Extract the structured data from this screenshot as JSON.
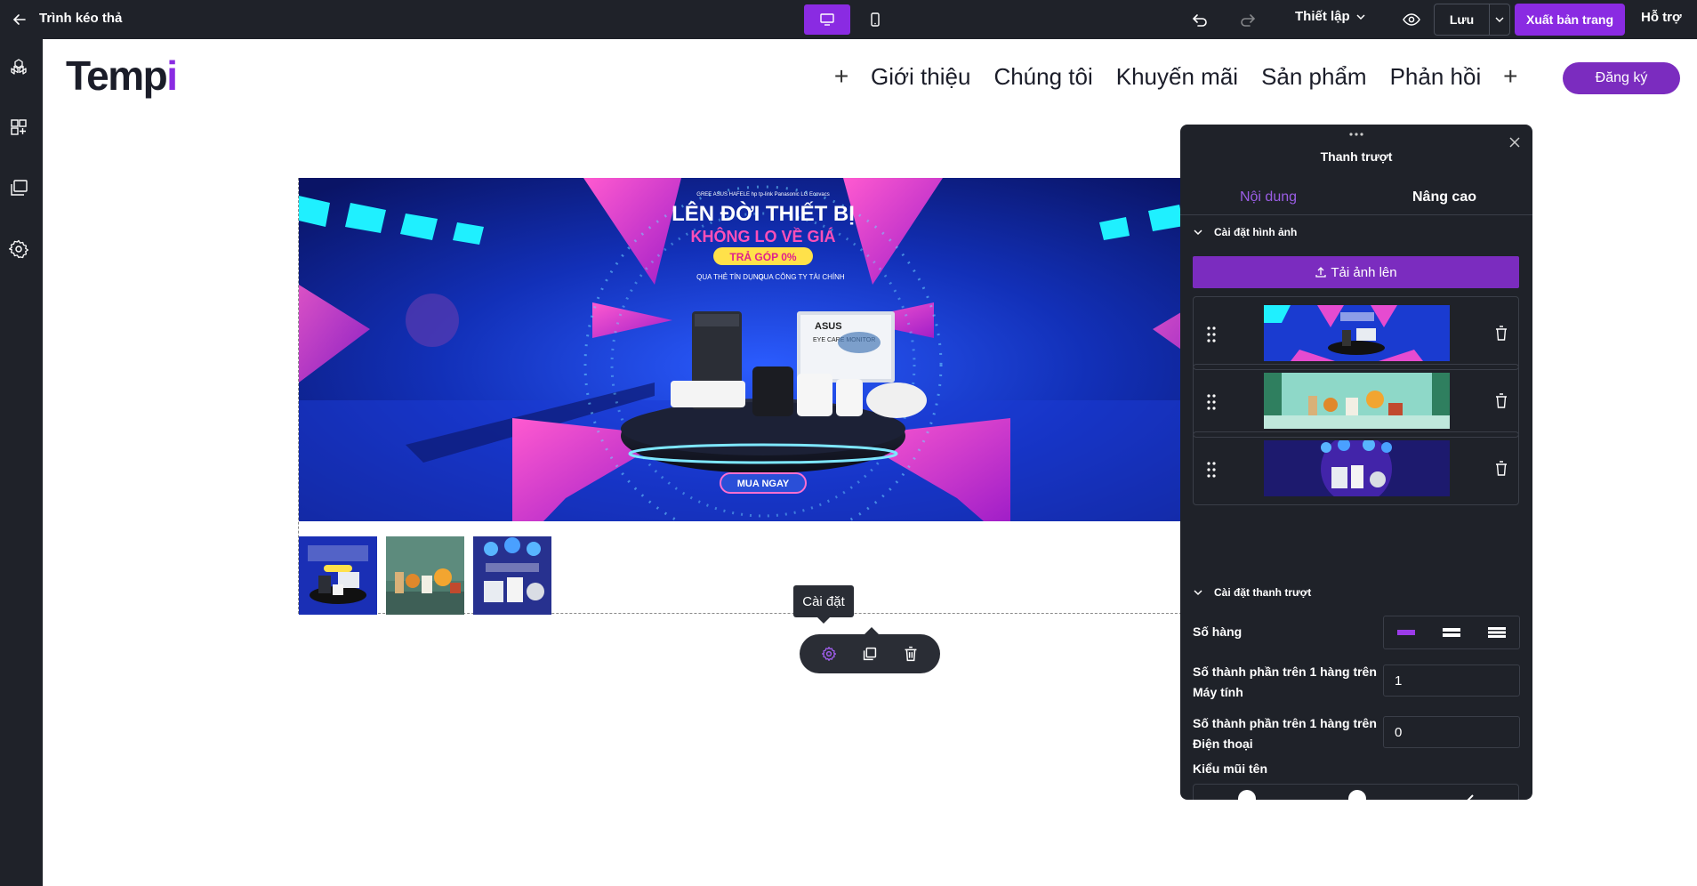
{
  "topbar": {
    "title": "Trình kéo thả",
    "setup_label": "Thiết lập",
    "save_label": "Lưu",
    "publish_label": "Xuất bản trang",
    "support_label": "Hỗ trợ",
    "device_active": "desktop"
  },
  "sidebar": {
    "icons": [
      "layers-icon",
      "widgets-icon",
      "pages-icon",
      "settings-icon"
    ]
  },
  "page": {
    "logo_main": "Temp",
    "logo_accent": "i",
    "nav_items": [
      "Giới thiệu",
      "Chúng tôi",
      "Khuyến mãi",
      "Sản phẩm",
      "Phản hồi"
    ],
    "register_label": "Đăng ký"
  },
  "banner": {
    "headline_1": "LÊN ĐỜI THIẾT BỊ",
    "headline_2": "KHÔNG LO VỀ GIÁ",
    "badge": "TRẢ GÓP 0%",
    "sub_left": "QUA THẺ TÍN DỤNG",
    "sub_right": "QUA CÔNG TY TÀI CHÍNH",
    "cta": "MUA NGAY",
    "brands": "GREE  ASUS  HAFELE  hp  tp-link  Panasonic  LG  Ecovacs",
    "monitor_brand": "ASUS",
    "monitor_text": "EYE CARE MONITOR"
  },
  "tooltip": {
    "label": "Cài đặt"
  },
  "panel": {
    "title": "Thanh trượt",
    "tabs": [
      "Nội dung",
      "Nâng cao"
    ],
    "section_images": "Cài đặt hình ảnh",
    "upload_label": "Tải ảnh lên",
    "section_slider": "Cài đặt thanh trượt",
    "rows_label": "Số hàng",
    "desktop_label_1": "Số thành phần trên 1 hàng trên",
    "desktop_label_2": "Máy tính",
    "desktop_value": "1",
    "mobile_label_1": "Số thành phần trên 1 hàng trên",
    "mobile_label_2": "Điện thoại",
    "mobile_value": "0",
    "arrow_label": "Kiểu mũi tên"
  },
  "colors": {
    "accent": "#8a2be2",
    "dark": "#1f2229",
    "register": "#7b2cbf"
  }
}
